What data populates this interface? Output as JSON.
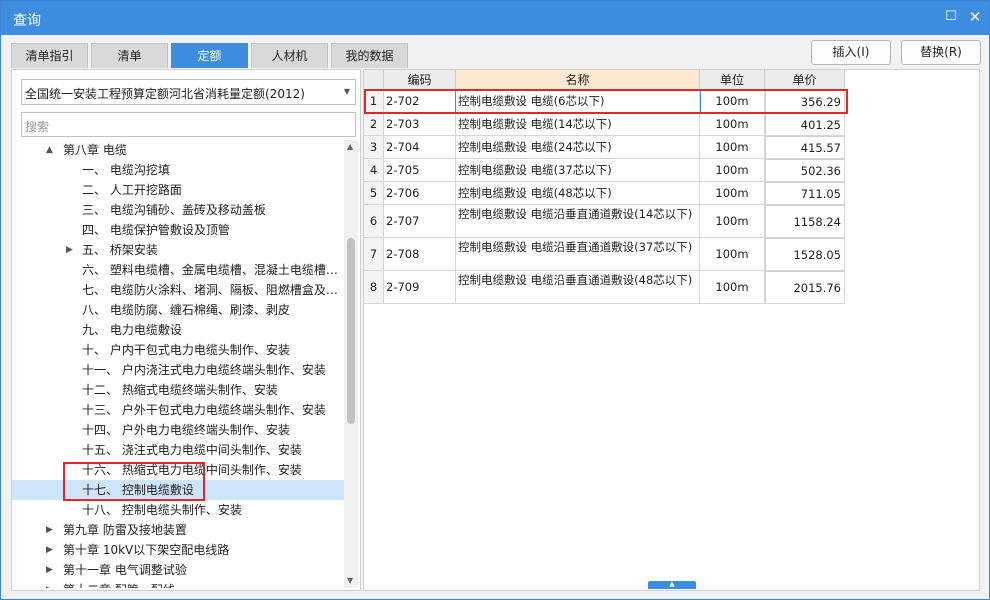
{
  "window": {
    "title": "查询",
    "restore_icon": "maximize-icon",
    "close_icon": "close-icon"
  },
  "tabs": [
    {
      "label": "清单指引",
      "active": false
    },
    {
      "label": "清单",
      "active": false
    },
    {
      "label": "定额",
      "active": true
    },
    {
      "label": "人材机",
      "active": false
    },
    {
      "label": "我的数据",
      "active": false
    }
  ],
  "buttons": {
    "insert": "插入(I)",
    "replace": "替换(R)"
  },
  "left": {
    "library_select": "全国统一安装工程预算定额河北省消耗量定额(2012)",
    "search_placeholder": "搜索",
    "tree": [
      {
        "label": "第八章 电缆",
        "level": 1,
        "expand": "▲"
      },
      {
        "label": "一、 电缆沟挖填",
        "level": 2
      },
      {
        "label": "二、 人工开挖路面",
        "level": 2
      },
      {
        "label": "三、 电缆沟铺砂、盖砖及移动盖板",
        "level": 2
      },
      {
        "label": "四、 电缆保护管敷设及顶管",
        "level": 2
      },
      {
        "label": "五、 桥架安装",
        "level": 2,
        "expand": "▶"
      },
      {
        "label": "六、 塑料电缆槽、金属电缆槽、混凝土电缆槽…",
        "level": 2
      },
      {
        "label": "七、 电缆防火涂料、堵洞、隔板、阻燃槽盒及…",
        "level": 2
      },
      {
        "label": "八、 电缆防腐、缠石棉绳、刷漆、剥皮",
        "level": 2
      },
      {
        "label": "九、 电力电缆敷设",
        "level": 2
      },
      {
        "label": "十、 户内干包式电力电缆头制作、安装",
        "level": 2
      },
      {
        "label": "十一、 户内浇注式电力电缆终端头制作、安装",
        "level": 2
      },
      {
        "label": "十二、 热缩式电缆终端头制作、安装",
        "level": 2
      },
      {
        "label": "十三、 户外干包式电力电缆终端头制作、安装",
        "level": 2
      },
      {
        "label": "十四、 户外电力电缆终端头制作、安装",
        "level": 2
      },
      {
        "label": "十五、 浇注式电力电缆中间头制作、安装",
        "level": 2
      },
      {
        "label": "十六、 热缩式电力电缆中间头制作、安装",
        "level": 2
      },
      {
        "label": "十七、 控制电缆敷设",
        "level": 2,
        "selected": true
      },
      {
        "label": "十八、 控制电缆头制作、安装",
        "level": 2
      },
      {
        "label": "第九章 防雷及接地装置",
        "level": 1,
        "expand": "▶"
      },
      {
        "label": "第十章 10kV以下架空配电线路",
        "level": 1,
        "expand": "▶"
      },
      {
        "label": "第十一章 电气调整试验",
        "level": 1,
        "expand": "▶"
      },
      {
        "label": "第十二章 配管、配线",
        "level": 1,
        "expand": "▶"
      }
    ]
  },
  "grid": {
    "headers": [
      "",
      "编码",
      "名称",
      "单位",
      "单价"
    ],
    "rows": [
      {
        "no": "1",
        "code": "2-702",
        "name": "控制电缆敷设 电缆(6芯以下)",
        "unit": "100m",
        "price": "356.29"
      },
      {
        "no": "2",
        "code": "2-703",
        "name": "控制电缆敷设 电缆(14芯以下)",
        "unit": "100m",
        "price": "401.25"
      },
      {
        "no": "3",
        "code": "2-704",
        "name": "控制电缆敷设 电缆(24芯以下)",
        "unit": "100m",
        "price": "415.57"
      },
      {
        "no": "4",
        "code": "2-705",
        "name": "控制电缆敷设 电缆(37芯以下)",
        "unit": "100m",
        "price": "502.36"
      },
      {
        "no": "5",
        "code": "2-706",
        "name": "控制电缆敷设 电缆(48芯以下)",
        "unit": "100m",
        "price": "711.05"
      },
      {
        "no": "6",
        "code": "2-707",
        "name": "控制电缆敷设 电缆沿垂直通道敷设(14芯以下)",
        "unit": "100m",
        "price": "1158.24"
      },
      {
        "no": "7",
        "code": "2-708",
        "name": "控制电缆敷设 电缆沿垂直通道敷设(37芯以下)",
        "unit": "100m",
        "price": "1528.05"
      },
      {
        "no": "8",
        "code": "2-709",
        "name": "控制电缆敷设 电缆沿垂直通道敷设(48芯以下)",
        "unit": "100m",
        "price": "2015.76"
      }
    ]
  },
  "colors": {
    "accent": "#3d8ee0",
    "highlight_box": "#e02828",
    "selection": "#cfe5fb"
  }
}
